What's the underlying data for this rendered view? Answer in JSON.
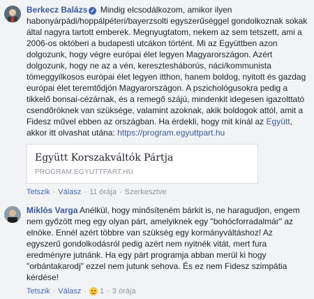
{
  "comments": [
    {
      "author": "Berkecz Balázs",
      "verified_mark": "✓",
      "text_part1": "Mindig elcsodálkozom, amikor ilyen habonyárpádi/hoppálpéteri/bayerzsolti egyszerűséggel gondolkoznak sokak által nagyra tartott emberek. Megnyugtatom, nekem az sem tetszett, ami a 2006-os októberi a budapesti utcákon történt. Mi az Együttben azon dolgozunk, hogy végre európai élet legyen Magyarországon. Azért dolgozunk, hogy ne az a vén, keresztesháborús, náci/kommunista tömeggyilkosos európai élet legyen itthon, hanem boldog, nyitott és gazdag európai élet teremtődjön Magyarországon. A pszichológusokra pedig a tikkelő bonsai-cézárnak, és a remegő szájú, mindenkit idegesen igazolttató csendőröknek van szüksége, valamint azoknak, akik boldogok attól, amit a Fidesz művel ebben az országban. Ha érdekli, hogy mit kínál az ",
      "link1": "Együtt",
      "text_part2": ", akkor itt olvashat utána: ",
      "link2": "https://program.egyuttpart.hu",
      "preview": {
        "title": "Együtt Korszakváltók Pártja",
        "domain": "PROGRAM.EGYUTTPART.HU"
      },
      "actions": {
        "like": "Tetszik",
        "reply": "Válasz",
        "time": "11 órája",
        "edited": "Szerkesztve"
      }
    },
    {
      "author": "Miklós Varga",
      "text": "Anélkül, hogy minősíteném bárkit is, ne haragudjon, engem nem győzött meg egy olyan párt, amelyiknek egy \"bohócforradalmár\" az elnöke. Ennél azért többre van szükség egy kormányváltáshoz! Az egyszerű gondolkodásról pedig azért nem nyitnék vitát, mert fura eredményre jutnánk. Ha egy párt programja abban merül ki hogy \"orbántakarodj\" ezzel nem jutunk sehova. És ez nem Fidesz szimpátia kérdése!",
      "actions": {
        "like": "Tetszik",
        "reply": "Válasz",
        "reactions_count": "1",
        "time": "3 órája"
      }
    }
  ]
}
